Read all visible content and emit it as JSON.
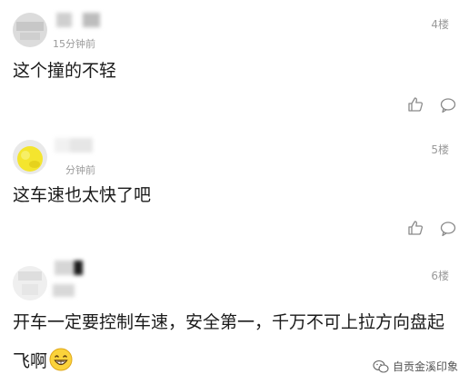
{
  "comments": [
    {
      "time": "15分钟前",
      "floor": "4楼",
      "text": "这个撞的不轻"
    },
    {
      "time": "分钟前",
      "floor": "5楼",
      "text": "这车速也太快了吧"
    },
    {
      "time": "",
      "floor": "6楼",
      "text_line1": "开车一定要控制车速，安全第一，千万不可上拉方向盘起",
      "text_line2": "飞啊"
    }
  ],
  "watermark": {
    "label": "自贡金溪印象"
  },
  "colors": {
    "background": "#ffffff",
    "divider": "#e2e2e2",
    "meta_text": "#9a9a9a",
    "body_text": "#1a1a1a",
    "avatar2": "#f4e52e"
  },
  "icons": {
    "like": "thumbs-up-icon",
    "reply": "speech-bubble-icon",
    "emoji": "grinning-face-emoji",
    "watermark": "wechat-bubble-icon"
  }
}
